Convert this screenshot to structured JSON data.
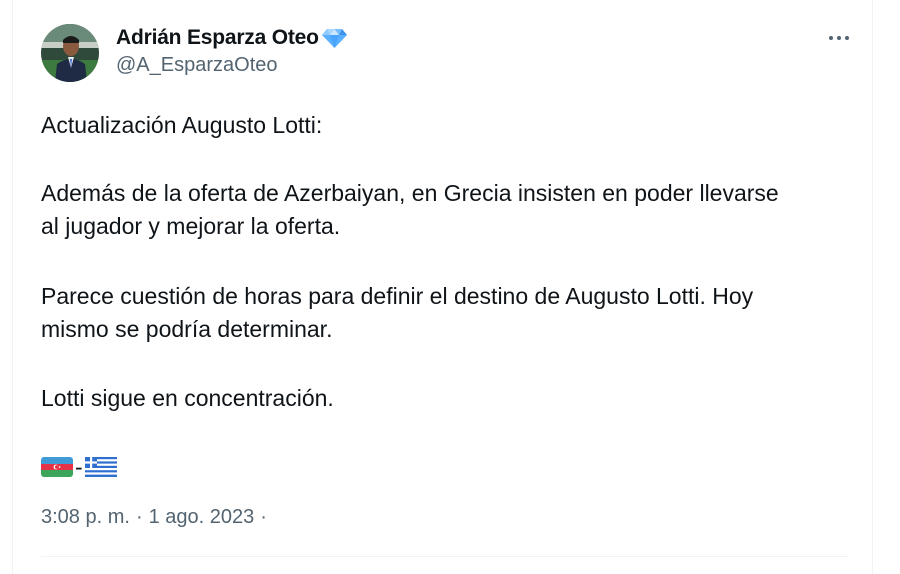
{
  "author": {
    "name": "Adrián Esparza Oteo",
    "handle": "@A_EsparzaOteo",
    "badge_icon": "verified-diamond-icon",
    "badge_color": "#4aa3ff"
  },
  "menu": {
    "icon": "more-horizontal-icon"
  },
  "tweet": {
    "line1": "Actualización Augusto Lotti:",
    "para2_line1": "Además de la oferta de Azerbaiyan, en Grecia insisten en poder llevarse",
    "para2_line2": "al jugador y mejorar la oferta.",
    "para3_line1": "Parece cuestión de horas para definir el destino de Augusto Lotti. Hoy",
    "para3_line2": "mismo se podría determinar.",
    "para4": "Lotti sigue en concentración.",
    "flags": {
      "first": "azerbaijan-flag-icon",
      "separator": "-",
      "second": "greece-flag-icon"
    }
  },
  "meta": {
    "time": "3:08 p. m.",
    "separator": "·",
    "date": "1 ago. 2023",
    "trailing": "·"
  },
  "colors": {
    "text": "#0f1419",
    "secondary": "#536471",
    "divider": "#eff3f4"
  }
}
